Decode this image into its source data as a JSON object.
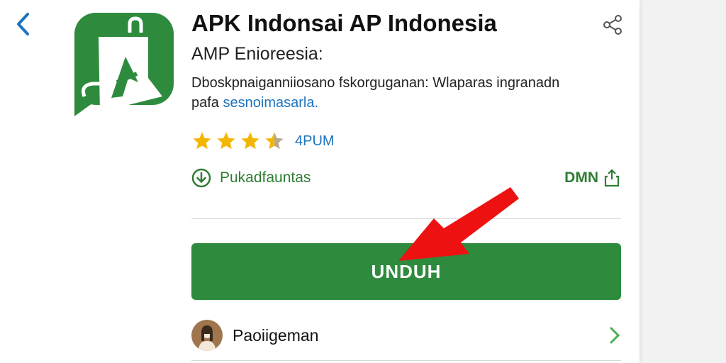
{
  "header": {
    "back_icon": "chevron-left-icon",
    "share_icon": "share-icon"
  },
  "app": {
    "title": "APK Indonsai AP Indonesia",
    "subtitle": "AMP Enioreesia:",
    "description_line1": "Dboskpnaiganniiosano fskorguganan: Wlaparas ingranadn",
    "description_prefix": "pafa",
    "description_link": "sesnoimasarla.",
    "icon_letter": "A",
    "brand_color": "#2e8b3e"
  },
  "rating": {
    "stars_value": 3.5,
    "stars_total": 5,
    "count_label": "4PUM"
  },
  "meta": {
    "category_label": "Pukadfauntas",
    "size_label": "DMN"
  },
  "actions": {
    "download_label": "UNDUH"
  },
  "developer": {
    "name": "Paoiigeman"
  }
}
